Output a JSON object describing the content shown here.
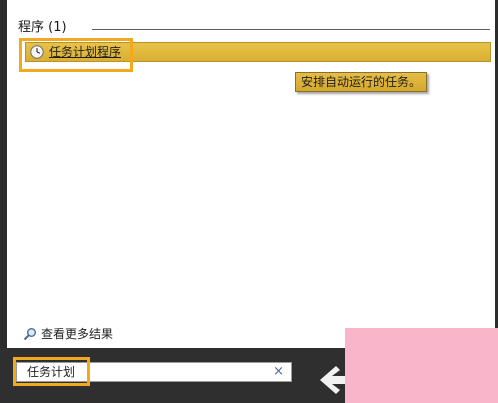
{
  "results": {
    "group_label": "程序 (1)",
    "item_label": "任务计划程序",
    "item_icon": "clock-icon",
    "tooltip": "安排自动运行的任务。",
    "see_more_label": "查看更多结果",
    "see_more_icon": "magnifier-icon"
  },
  "search": {
    "value": "任务计划",
    "clear_glyph": "×"
  },
  "colors": {
    "selection": "#ddb53a",
    "highlight_box": "#f2a91e",
    "bottom_bar": "#2f2f2f",
    "pink_overlay": "#f9b5ca"
  }
}
